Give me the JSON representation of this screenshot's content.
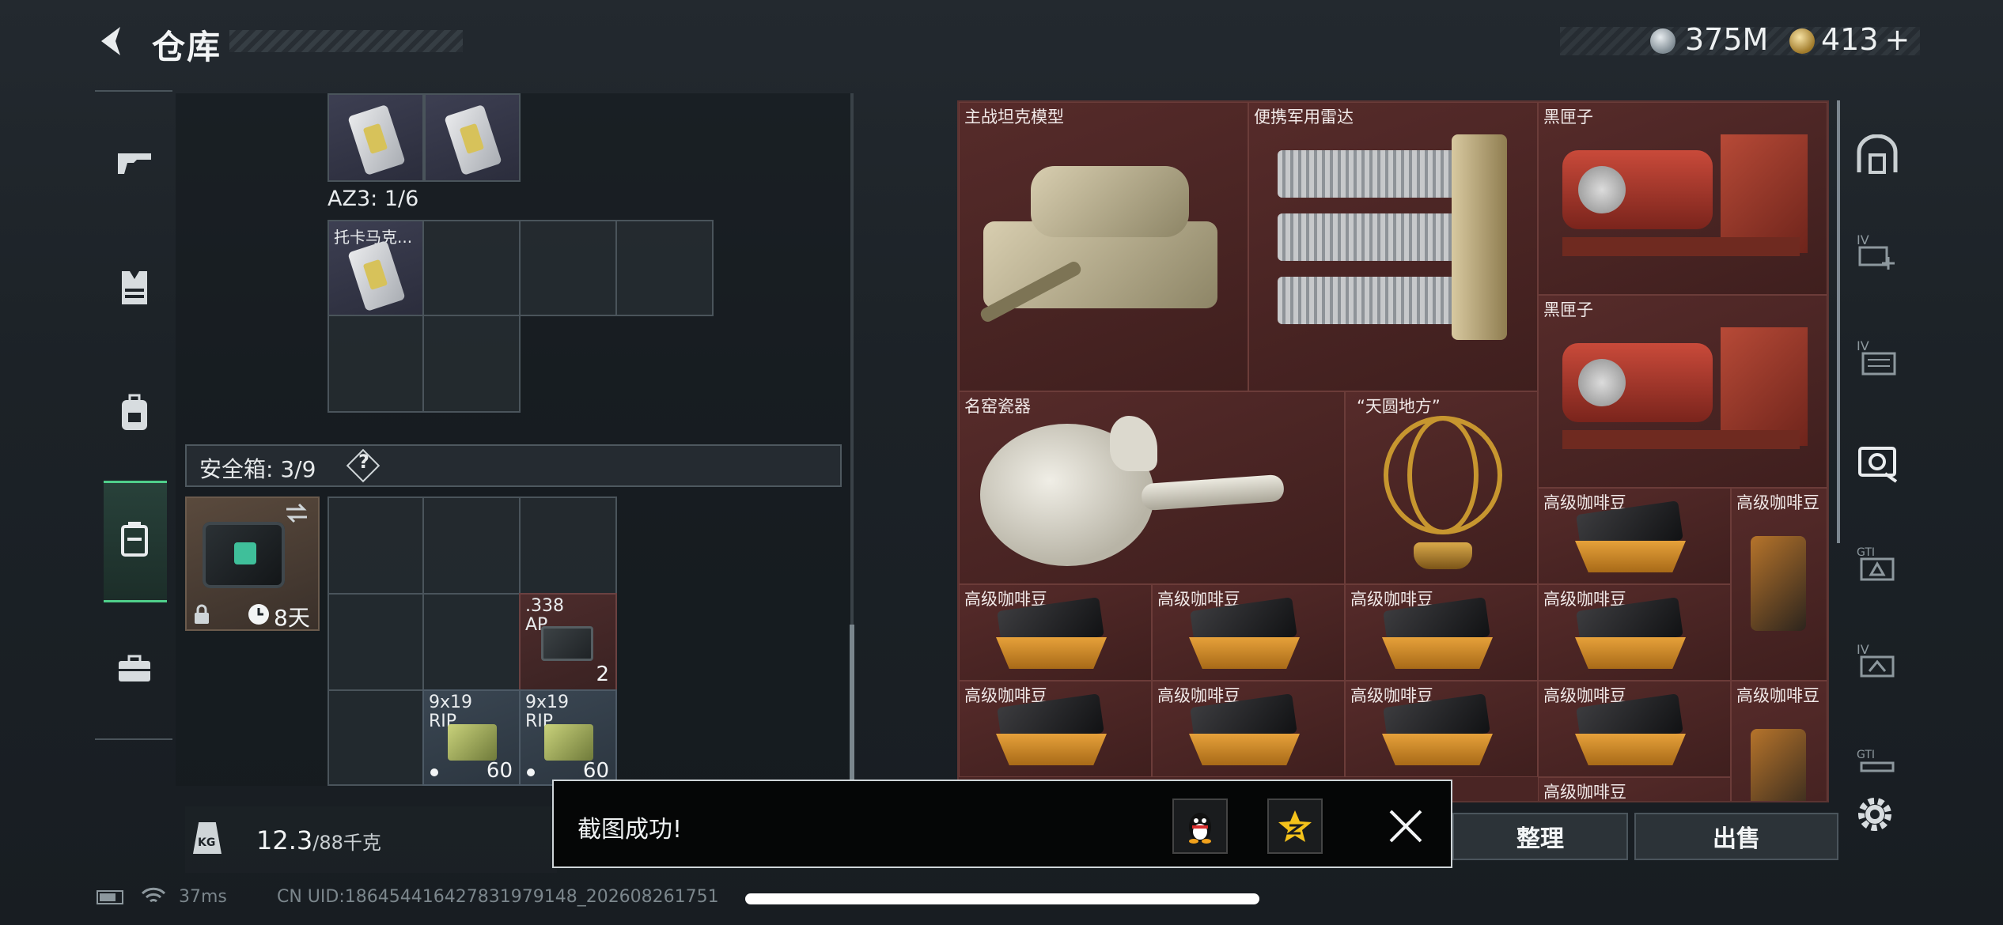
{
  "header": {
    "title": "仓库",
    "currency_silver": "375M",
    "currency_gold": "413",
    "currency_gold_suffix": "+"
  },
  "left_grid": {
    "az3_label": "AZ3: 1/6",
    "tokarev_label": "托卡马克...",
    "safebox_label": "安全箱: 3/9",
    "help_label": "?",
    "safebox_timer": "8天",
    "ammo_338_label": ".338\nAP",
    "ammo_338_line1": ".338",
    "ammo_338_line2": "AP",
    "ammo_338_qty": "2",
    "ammo_9x19_a_line1": "9x19",
    "ammo_9x19_a_line2": "RIP",
    "ammo_9x19_a_qty": "60",
    "ammo_9x19_b_line1": "9x19",
    "ammo_9x19_b_line2": "RIP",
    "ammo_9x19_b_qty": "60"
  },
  "weight": {
    "value": "12.3",
    "capacity": "/88千克",
    "icon_text": "KG"
  },
  "stash_items": {
    "tank": "主战坦克模型",
    "radar": "便携军用雷达",
    "blackbox_1": "黑匣子",
    "blackbox_2": "黑匣子",
    "porcelain": "名窑瓷器",
    "globe": "“天圆地方”",
    "coffee": "高级咖啡豆"
  },
  "buttons": {
    "organize": "整理",
    "sell": "出售"
  },
  "toast": {
    "message": "截图成功!"
  },
  "status_bar": {
    "ping": "37ms",
    "uid": "CN UID:1864544164278319791​48_202608261751"
  },
  "colors": {
    "accent_green": "#4fcf8b",
    "stash_bg": "#4a2524",
    "coffee_gold": "#e6a13a"
  }
}
